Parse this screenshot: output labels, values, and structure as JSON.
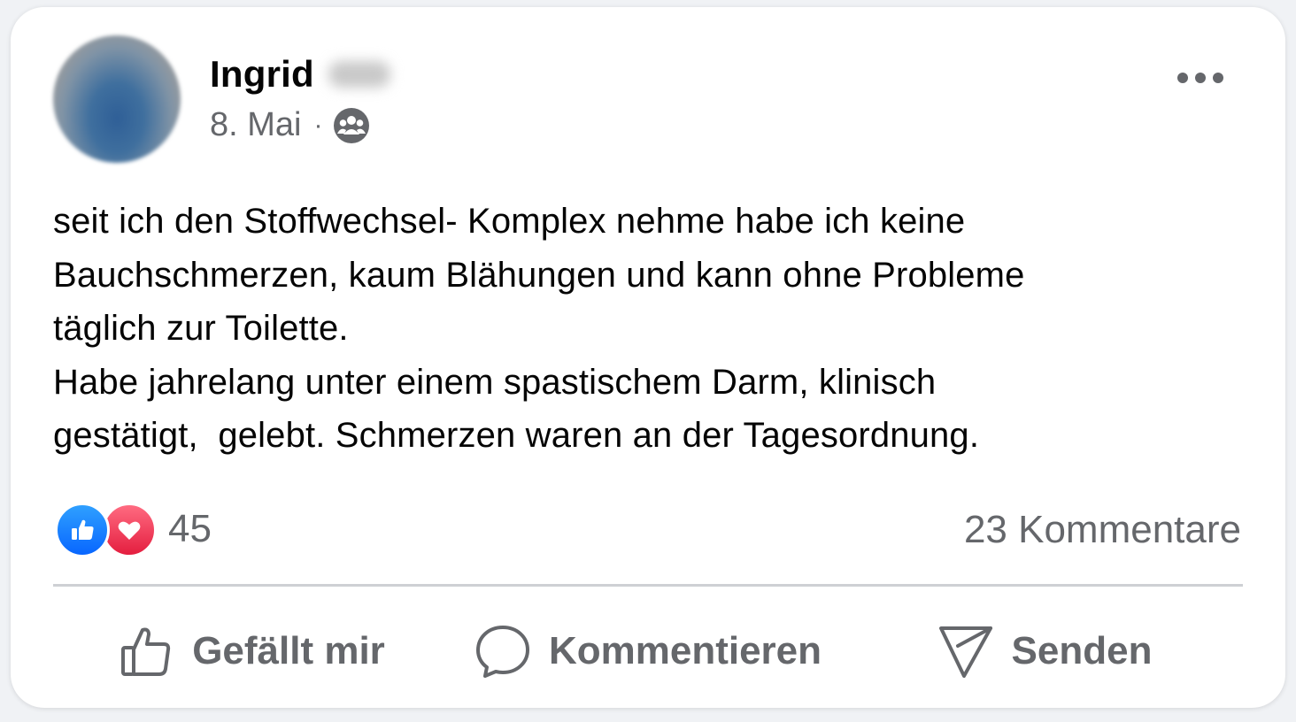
{
  "post": {
    "author_name": "Ingrid",
    "date": "8. Mai",
    "separator": "·",
    "audience_icon": "group-icon",
    "body": "seit ich den Stoffwechsel- Komplex nehme habe ich keine\nBauchschmerzen, kaum Blähungen und kann ohne Probleme\ntäglich zur Toilette.\nHabe jahrelang unter einem spastischem Darm, klinisch\ngestätigt,  gelebt. Schmerzen waren an der Tagesordnung."
  },
  "reactions": {
    "types": [
      "like",
      "love"
    ],
    "count": "45"
  },
  "comments": {
    "label": "23 Kommentare"
  },
  "actions": {
    "like": "Gefällt mir",
    "comment": "Kommentieren",
    "send": "Senden"
  },
  "colors": {
    "like_blue": "#0866ff",
    "love_red": "#e41e3f",
    "secondary_text": "#65676b",
    "divider": "#ced0d4"
  }
}
